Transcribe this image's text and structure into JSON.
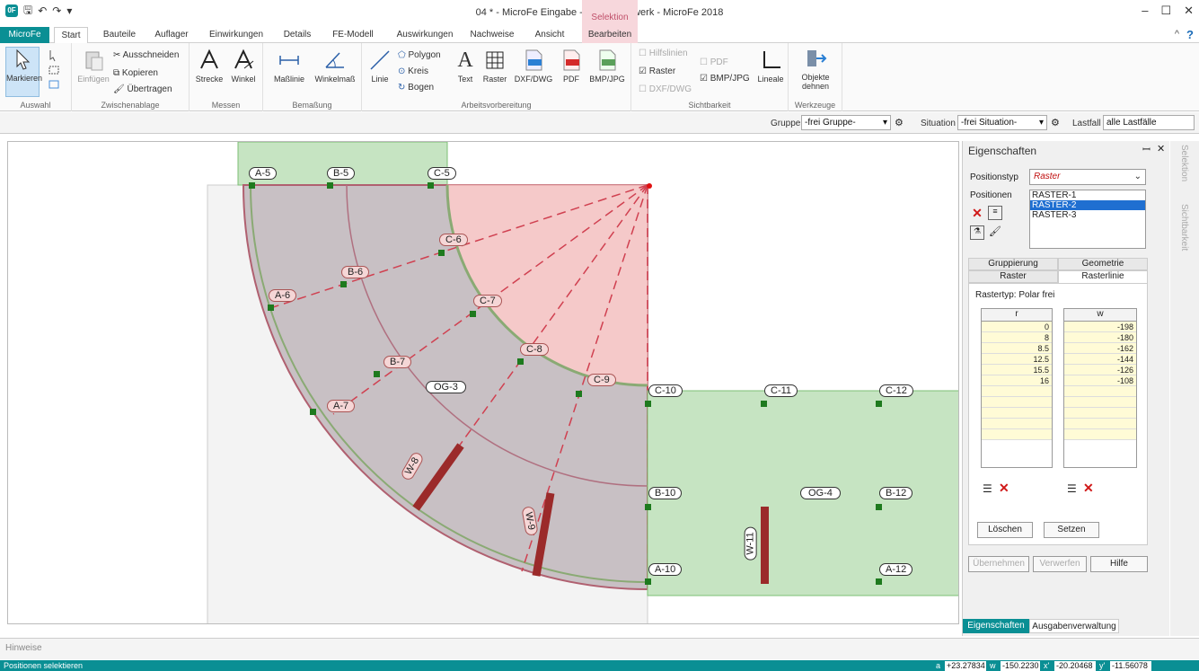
{
  "window": {
    "title": "04 * - MicroFe Eingabe - Plattentragwerk - MicroFe 2018",
    "ctx_group": "Selektion",
    "min": "–",
    "max": "☐",
    "close": "✕",
    "help": "?",
    "collapse": "^"
  },
  "tabs": [
    "MicroFe",
    "Start",
    "Bauteile",
    "Auflager",
    "Einwirkungen",
    "Details",
    "FE-Modell",
    "Auswirkungen",
    "Nachweise",
    "Ansicht",
    "Bearbeiten"
  ],
  "ribbon": {
    "auswahl": {
      "label": "Auswahl",
      "markieren": "Markieren"
    },
    "clipboard": {
      "label": "Zwischenablage",
      "einfuegen": "Einfügen",
      "ausschneiden": "Ausschneiden",
      "kopieren": "Kopieren",
      "uebertragen": "Übertragen"
    },
    "messen": {
      "label": "Messen",
      "strecke": "Strecke",
      "winkel": "Winkel"
    },
    "bemassung": {
      "label": "Bemaßung",
      "masslinie": "Maßlinie",
      "winkelmass": "Winkelmaß"
    },
    "arbeits": {
      "label": "Arbeitsvorbereitung",
      "linie": "Linie",
      "polygon": "Polygon",
      "kreis": "Kreis",
      "bogen": "Bogen",
      "text": "Text",
      "raster": "Raster",
      "dxf": "DXF/DWG",
      "pdf": "PDF",
      "bmp": "BMP/JPG"
    },
    "sicht": {
      "label": "Sichtbarkeit",
      "hilfslinien": "Hilfslinien",
      "pdf": "PDF",
      "raster": "Raster",
      "bmp": "BMP/JPG",
      "dxf": "DXF/DWG",
      "lineale": "Lineale"
    },
    "werkzeuge": {
      "label": "Werkzeuge",
      "objekte1": "Objekte",
      "objekte2": "dehnen"
    }
  },
  "toolbar": {
    "gruppe_label": "Gruppe",
    "gruppe_value": "-frei Gruppe-",
    "situation_label": "Situation",
    "situation_value": "-frei Situation-",
    "lastfall_label": "Lastfall",
    "lastfall_value": "alle Lastfälle"
  },
  "panel": {
    "title": "Eigenschaften",
    "pin": "ꟷ",
    "close": "✕",
    "positionstyp_label": "Positionstyp",
    "positionstyp_value": "Raster",
    "positionen_label": "Positionen",
    "positionen": [
      "RASTER-1",
      "RASTER-2",
      "RASTER-3"
    ],
    "subtabs_top": [
      "Gruppierung",
      "Geometrie"
    ],
    "subtabs_bottom": [
      "Raster",
      "Rasterlinie"
    ],
    "rastertyp": "Rastertyp: Polar frei",
    "col_r": "r",
    "col_w": "w",
    "r_values": [
      "0",
      "8",
      "8.5",
      "12.5",
      "15.5",
      "16"
    ],
    "w_values": [
      "-198",
      "-180",
      "-162",
      "-144",
      "-126",
      "-108"
    ],
    "loeschen": "Löschen",
    "setzen": "Setzen",
    "uebernehmen": "Übernehmen",
    "verwerfen": "Verwerfen",
    "hilfe": "Hilfe",
    "bottom_tabs": [
      "Eigenschaften",
      "Ausgabenverwaltung"
    ]
  },
  "sidestrip": {
    "selektion": "Selektion",
    "sichtbarkeit": "Sichtbarkeit"
  },
  "hinweise": "Hinweise",
  "status": {
    "text": "Positionen selektieren",
    "a": "a",
    "a_val": "+23.27834",
    "w": "w",
    "w_val": "-150.2230",
    "x": "x'",
    "x_val": "-20.20468",
    "y": "y'",
    "y_val": "-11.56078"
  },
  "canvas_labels": {
    "axes": [
      "A-5",
      "B-5",
      "C-5",
      "C-6",
      "B-6",
      "A-6",
      "C-7",
      "C-8",
      "B-7",
      "A-7",
      "C-9",
      "C-10",
      "C-11",
      "C-12",
      "B-10",
      "B-12",
      "A-10",
      "A-12"
    ],
    "positions": [
      "OG-3",
      "OG-4"
    ],
    "walls": [
      "W-8",
      "W-9",
      "W-11"
    ]
  }
}
